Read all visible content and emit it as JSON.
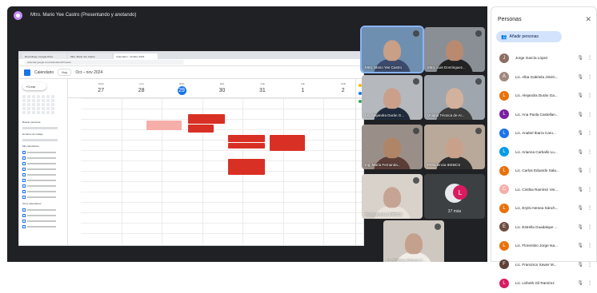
{
  "presenter": {
    "title": "Mtro. Mario Yee Castro (Presentando y anotando)"
  },
  "browser": {
    "tabs": [
      "Recordings | Google Drive",
      "Mtro. Mario Yee Castro",
      "Calendario - Octubre 2024"
    ],
    "url": "calendar.google.com/calendar/u/0/r/week"
  },
  "calendar": {
    "app_title": "Calendario",
    "today_label": "Hoy",
    "month_label": "Oct – nov 2024",
    "create_label": "Crear",
    "days": [
      {
        "dow": "DOM",
        "num": "27"
      },
      {
        "dow": "LUN",
        "num": "28"
      },
      {
        "dow": "MAR",
        "num": "29"
      },
      {
        "dow": "MIÉ",
        "num": "30"
      },
      {
        "dow": "JUE",
        "num": "31"
      },
      {
        "dow": "VIE",
        "num": "1"
      },
      {
        "dow": "SÁB",
        "num": "2"
      }
    ],
    "side_labels": [
      "Buscar personas",
      "Horarios de trabajo",
      "Mis calendarios",
      "Otros calendarios"
    ]
  },
  "tiles": [
    {
      "name": "Mtro. Mario Yee Castro",
      "face": "#c99f86",
      "body": "#3b4a6b",
      "bg": "#6f8fb0",
      "active": true
    },
    {
      "name": "Mtro. Luis Domínguez...",
      "face": "#b98a70",
      "body": "#222222",
      "bg": "#8a8f96",
      "active": false
    },
    {
      "name": "Lic. Alejandra Durán G...",
      "face": "#caa08a",
      "body": "#1f2b3c",
      "bg": "#b5b8bd",
      "active": false
    },
    {
      "name": "Unidad Técnica de Ar...",
      "face": "#d2b29c",
      "body": "#3d3d3d",
      "bg": "#a0a6ad",
      "active": false
    },
    {
      "name": "Ing. María Fernanda...",
      "face": "#b08466",
      "body": "#5a3d36",
      "bg": "#9a8f88",
      "active": false
    },
    {
      "name": "Presidencia IEEBCS",
      "face": "#c9a18a",
      "body": "#2f2f2f",
      "bg": "#b8a99b",
      "active": false
    },
    {
      "name": "Transparencia IEEBCS",
      "face": "#c6a493",
      "body": "#e9e3dc",
      "bg": "#d8d2cb",
      "active": false
    },
    {
      "name": "Lic. Dolores Salazar C...",
      "face": "#c4a18d",
      "body": "#f1ede8",
      "bg": "#cfc8c0",
      "active": false
    }
  ],
  "more": {
    "count_label": "37 más",
    "initial": "L"
  },
  "people": {
    "title": "Personas",
    "add_label": "Añadir personas",
    "list": [
      {
        "name": "Jorge García López",
        "initial": "J",
        "color": "#8d6e63"
      },
      {
        "name": "Lic. Alba Gabriela Jimén...",
        "initial": "A",
        "color": "#a1887f"
      },
      {
        "name": "Lic. Alejandra Durán Ga...",
        "initial": "L",
        "color": "#e8710a"
      },
      {
        "name": "Lic. Ana Paola Castellan...",
        "initial": "L",
        "color": "#7b1fa2"
      },
      {
        "name": "Lic. Anabel Ibarra Caru...",
        "initial": "L",
        "color": "#1a73e8"
      },
      {
        "name": "Lic. Arianna Carballo Lu...",
        "initial": "L",
        "color": "#039be5"
      },
      {
        "name": "Lic. Carlos Eduardo Sala...",
        "initial": "L",
        "color": "#e8710a"
      },
      {
        "name": "Lic. Cinthia Ramírez Ver...",
        "initial": "C",
        "color": "#f6aea9"
      },
      {
        "name": "Lic. Erylsi Atenea Sánch...",
        "initial": "L",
        "color": "#e8710a"
      },
      {
        "name": "Lic. Estrella Guadalupe ...",
        "initial": "E",
        "color": "#6d4c41"
      },
      {
        "name": "Lic. Florentino Jorge Isa...",
        "initial": "L",
        "color": "#e8710a"
      },
      {
        "name": "Lic. Francisco Xavier M...",
        "initial": "F",
        "color": "#5d4037"
      },
      {
        "name": "Lic. Lizbeth Gil Ramírez",
        "initial": "L",
        "color": "#d81b60"
      }
    ]
  }
}
